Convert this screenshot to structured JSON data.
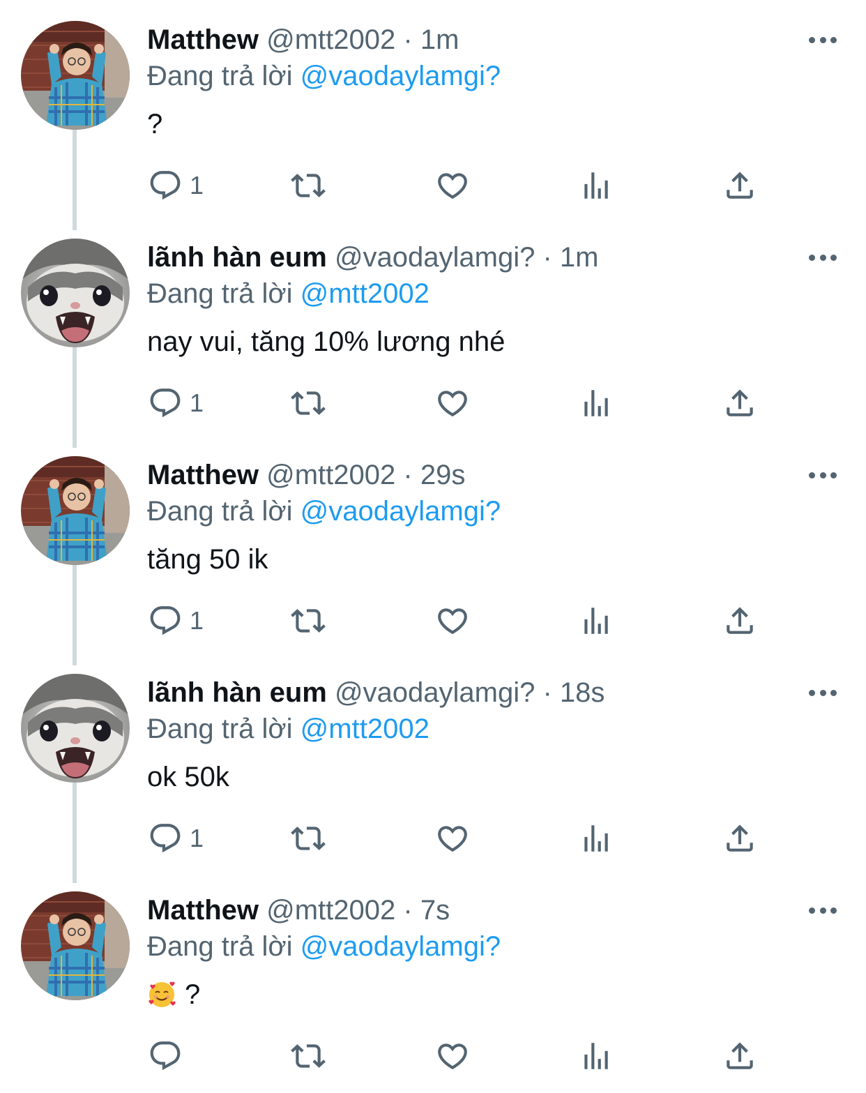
{
  "tweets": [
    {
      "author": "Matthew",
      "handle": "@mtt2002",
      "time": "· 1m",
      "reply_prefix": "Đang trả lời",
      "reply_to": "@vaodaylamgi?",
      "text": "?",
      "emoji": "",
      "reply_count": "1",
      "avatar": "photo-person-icon"
    },
    {
      "author": "lãnh hàn eum",
      "handle": "@vaodaylamgi?",
      "time": "· 1m",
      "reply_prefix": "Đang trả lời",
      "reply_to": "@mtt2002",
      "text": "nay vui, tăng 10% lương nhé",
      "emoji": "",
      "reply_count": "1",
      "avatar": "crying-cat-icon"
    },
    {
      "author": "Matthew",
      "handle": "@mtt2002",
      "time": "· 29s",
      "reply_prefix": "Đang trả lời",
      "reply_to": "@vaodaylamgi?",
      "text": "tăng 50 ik",
      "emoji": "",
      "reply_count": "1",
      "avatar": "photo-person-icon"
    },
    {
      "author": "lãnh hàn eum",
      "handle": "@vaodaylamgi?",
      "time": "· 18s",
      "reply_prefix": "Đang trả lời",
      "reply_to": "@mtt2002",
      "text": "ok 50k",
      "emoji": "",
      "reply_count": "1",
      "avatar": "crying-cat-icon"
    },
    {
      "author": "Matthew",
      "handle": "@mtt2002",
      "time": "· 7s",
      "reply_prefix": "Đang trả lời",
      "reply_to": "@vaodaylamgi?",
      "text": "?",
      "emoji": "smiling-face-with-hearts-icon",
      "reply_count": "",
      "avatar": "photo-person-icon"
    }
  ],
  "colors": {
    "text_primary": "#0f1419",
    "text_secondary": "#536471",
    "mention": "#1d9bf0",
    "thread_line": "#cfd9de"
  }
}
